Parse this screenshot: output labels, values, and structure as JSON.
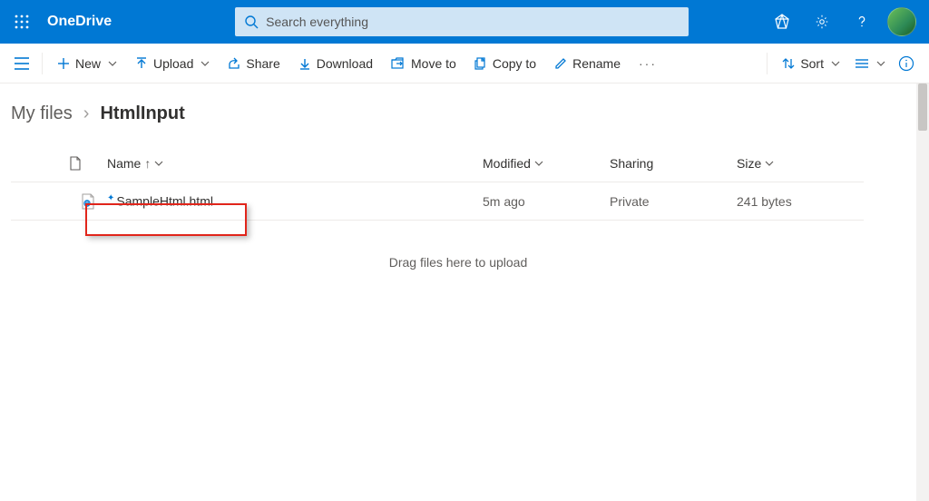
{
  "topbar": {
    "brand": "OneDrive",
    "search_placeholder": "Search everything"
  },
  "commands": {
    "new": "New",
    "upload": "Upload",
    "share": "Share",
    "download": "Download",
    "move_to": "Move to",
    "copy_to": "Copy to",
    "rename": "Rename",
    "sort": "Sort"
  },
  "breadcrumb": {
    "root": "My files",
    "current": "HtmlInput"
  },
  "columns": {
    "name": "Name",
    "modified": "Modified",
    "sharing": "Sharing",
    "size": "Size"
  },
  "rows": [
    {
      "name": "SampleHtml.html",
      "modified": "5m ago",
      "sharing": "Private",
      "size": "241 bytes"
    }
  ],
  "dropzone": "Drag files here to upload"
}
